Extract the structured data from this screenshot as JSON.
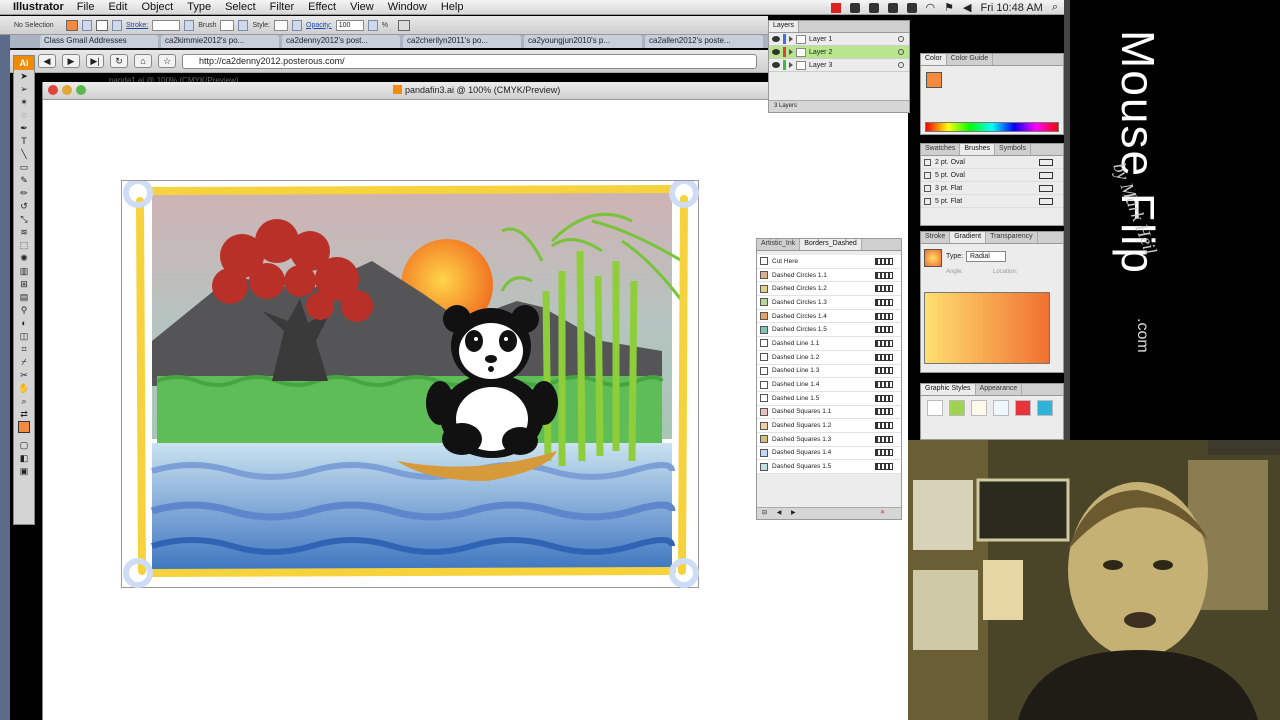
{
  "menubar": {
    "app": "Illustrator",
    "items": [
      "File",
      "Edit",
      "Object",
      "Type",
      "Select",
      "Filter",
      "Effect",
      "View",
      "Window",
      "Help"
    ],
    "clock": "Fri 10:48 AM"
  },
  "controlbar": {
    "selection": "No Selection",
    "stroke_label": "Stroke:",
    "brush_label": "Brush",
    "style_label": "Style:",
    "opacity_label": "Opacity:",
    "opacity_value": "100",
    "opacity_unit": "%"
  },
  "browser": {
    "tabs": [
      "Class Gmail Addresses",
      "ca2kimmie2012's po...",
      "ca2denny2012's post...",
      "ca2cherilyn2011's po...",
      "ca2youngjun2010's p...",
      "ca2allen2012's poste..."
    ],
    "url": "http://ca2denny2012.posterous.com/"
  },
  "document": {
    "background_title": "panda1.ai @ 100% (CMYK/Preview)",
    "title": "pandafin3.ai @ 100% (CMYK/Preview)"
  },
  "layers_panel": {
    "tab": "Layers",
    "layers": [
      {
        "name": "Layer 1",
        "color": "#3b6ee8",
        "selected": false
      },
      {
        "name": "Layer 2",
        "color": "#e23b3b",
        "selected": true
      },
      {
        "name": "Layer 3",
        "color": "#3bbf3b",
        "selected": false
      }
    ],
    "footer": "3 Layers"
  },
  "color_panel": {
    "tabs": [
      "Color",
      "Color Guide"
    ]
  },
  "brushes_panel": {
    "tabs": [
      "Swatches",
      "Brushes",
      "Symbols"
    ],
    "items": [
      "2 pt. Oval",
      "5 pt. Oval",
      "3 pt. Flat",
      "5 pt. Flat"
    ]
  },
  "gradient_panel": {
    "tabs": [
      "Stroke",
      "Gradient",
      "Transparency"
    ],
    "type_label": "Type:",
    "type_value": "Radial",
    "angle_label": "Angle:",
    "location_label": "Location:"
  },
  "styles_panel": {
    "tabs": [
      "Graphic Styles",
      "Appearance"
    ],
    "swatches": [
      "#ffffff",
      "#9ed34f",
      "#fff9ea",
      "#eef6ff",
      "#e8323c",
      "#2fb3d8"
    ]
  },
  "borders_panel": {
    "tabs": [
      "Artistic_Ink",
      "Borders_Dashed"
    ],
    "items": [
      "Cut Here",
      "Dashed Circles 1.1",
      "Dashed Circles 1.2",
      "Dashed Circles 1.3",
      "Dashed Circles 1.4",
      "Dashed Circles 1.5",
      "Dashed Line 1.1",
      "Dashed Line 1.2",
      "Dashed Line 1.3",
      "Dashed Line 1.4",
      "Dashed Line 1.5",
      "Dashed Squares 1.1",
      "Dashed Squares 1.2",
      "Dashed Squares 1.3",
      "Dashed Squares 1.4",
      "Dashed Squares 1.5"
    ],
    "icon_colors": [
      "#ffffff",
      "#d9b08c",
      "#e0d28a",
      "#b7d89a",
      "#e8a060",
      "#7dc4b6",
      "#ffffff",
      "#ffffff",
      "#ffffff",
      "#ffffff",
      "#ffffff",
      "#e8c0c0",
      "#f0d0a0",
      "#d0c080",
      "#c0d8f0",
      "#c0e0e8"
    ]
  },
  "branding": {
    "title": "Mouse Flip",
    "byline": "by Mark Heil",
    "domain": ".com"
  }
}
